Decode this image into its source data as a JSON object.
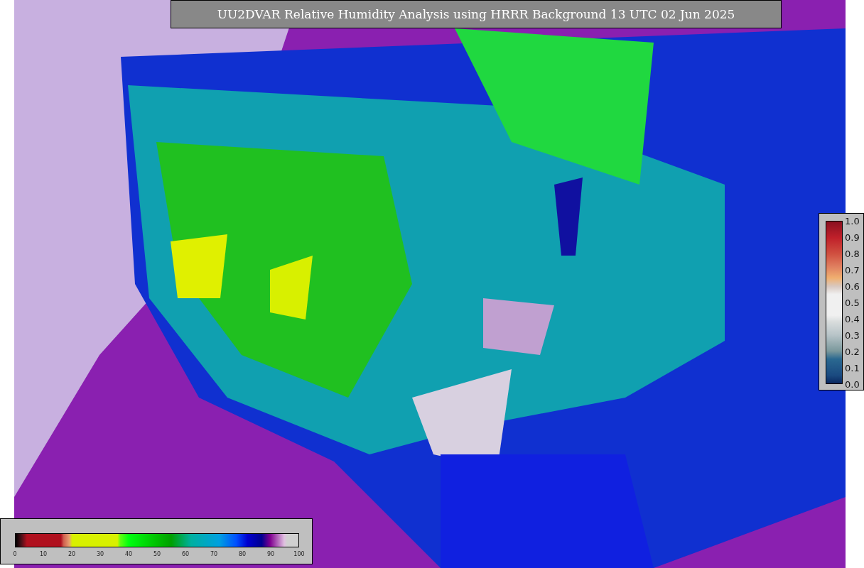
{
  "title": "UU2DVAR Relative Humidity Analysis using HRRR Background 13 UTC 02 Jun 2025",
  "humidity_colorbar": {
    "ticks": [
      "0",
      "10",
      "20",
      "30",
      "40",
      "50",
      "60",
      "70",
      "80",
      "90",
      "100"
    ]
  },
  "observation_colorbar": {
    "ticks": [
      "1.0",
      "0.9",
      "0.8",
      "0.7",
      "0.6",
      "0.5",
      "0.4",
      "0.3",
      "0.2",
      "0.1",
      "0.0"
    ]
  }
}
